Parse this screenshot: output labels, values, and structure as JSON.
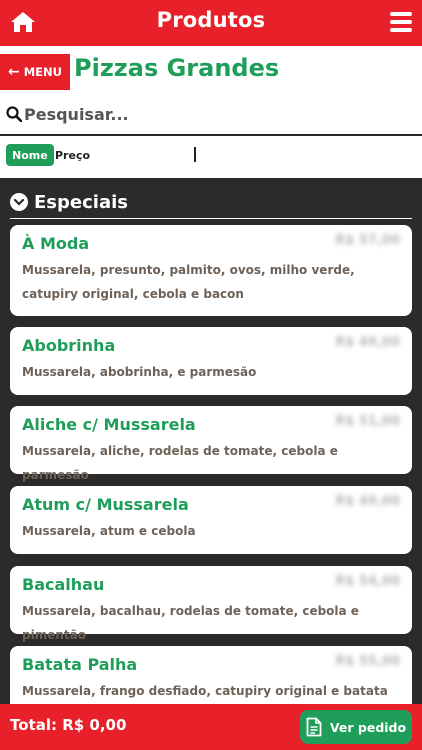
{
  "header": {
    "title": "Produtos",
    "home_icon": "home-icon",
    "menu_icon": "hamburger-icon"
  },
  "category": {
    "back_label": "MENU",
    "title": "Pizzas Grandes"
  },
  "search": {
    "placeholder": "Pesquisar..."
  },
  "sort": {
    "options": [
      "Nome",
      "Preço"
    ],
    "active": "Nome"
  },
  "section": {
    "label": "Especiais"
  },
  "products": [
    {
      "name": "À Moda",
      "description": "Mussarela, presunto, palmito, ovos, milho verde, catupiry original, cebola e bacon",
      "price": "R$ 57,00"
    },
    {
      "name": "Abobrinha",
      "description": "Mussarela, abobrinha, e parmesão",
      "price": "R$ 49,00"
    },
    {
      "name": "Aliche c/ Mussarela",
      "description": "Mussarela, aliche, rodelas de tomate, cebola e parmesão",
      "price": "R$ 51,00"
    },
    {
      "name": "Atum c/ Mussarela",
      "description": "Mussarela, atum e cebola",
      "price": "R$ 49,00"
    },
    {
      "name": "Bacalhau",
      "description": "Mussarela, bacalhau, rodelas de tomate, cebola e pimentão",
      "price": "R$ 54,00"
    },
    {
      "name": "Batata Palha",
      "description": "Mussarela, frango desfiado, catupiry original e batata palha",
      "price": "R$ 55,00"
    }
  ],
  "footer": {
    "total_label": "Total: R$ 0,00",
    "order_label": "Ver pedido"
  },
  "colors": {
    "primary_red": "#e8202a",
    "accent_green": "#1f9e5a",
    "background_dark": "#2b2b2b"
  }
}
